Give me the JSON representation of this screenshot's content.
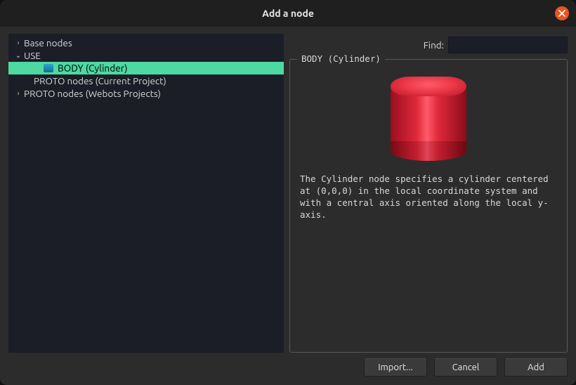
{
  "window": {
    "title": "Add a node"
  },
  "tree": {
    "items": [
      {
        "label": "Base nodes",
        "expandable": true,
        "expanded": false,
        "depth": 0
      },
      {
        "label": "USE",
        "expandable": true,
        "expanded": true,
        "depth": 0
      },
      {
        "label": "BODY (Cylinder)",
        "expandable": false,
        "expanded": false,
        "depth": 2,
        "selected": true,
        "icon": "node-icon"
      },
      {
        "label": "PROTO nodes (Current Project)",
        "expandable": false,
        "expanded": false,
        "depth": 1
      },
      {
        "label": "PROTO nodes (Webots Projects)",
        "expandable": true,
        "expanded": false,
        "depth": 0
      }
    ]
  },
  "find": {
    "label": "Find:",
    "value": "",
    "placeholder": ""
  },
  "detail": {
    "legend": "BODY (Cylinder)",
    "description": "The Cylinder node specifies a cylinder centered at (0,0,0) in the local coordinate system and with a central axis oriented along the local y-axis.",
    "preview": {
      "shape": "cylinder",
      "color": "#e02a3b"
    }
  },
  "buttons": {
    "import": "Import...",
    "cancel": "Cancel",
    "add": "Add"
  }
}
